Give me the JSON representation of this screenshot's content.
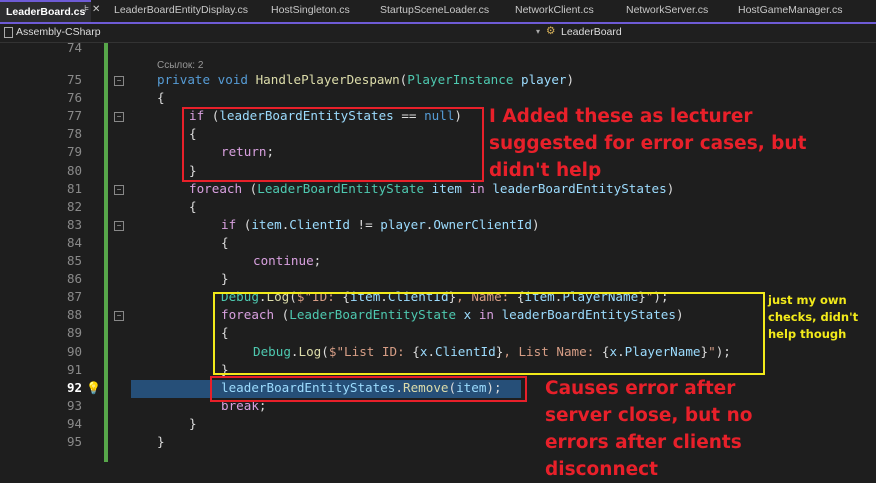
{
  "tabs": [
    {
      "label": "LeaderBoard.cs",
      "active": true
    },
    {
      "label": "LeaderBoardEntityDisplay.cs"
    },
    {
      "label": "HostSingleton.cs"
    },
    {
      "label": "StartupSceneLoader.cs"
    },
    {
      "label": "NetworkClient.cs"
    },
    {
      "label": "NetworkServer.cs"
    },
    {
      "label": "HostGameManager.cs"
    }
  ],
  "navbar": {
    "project": "Assembly-CSharp",
    "member": "LeaderBoard"
  },
  "codelens": "Ссылок: 2",
  "current_line": 92,
  "lines": [
    {
      "n": 74,
      "indent": 0,
      "t": []
    },
    {
      "n": 75,
      "indent": 0,
      "fold": true,
      "t": [
        [
          "private ",
          "kw"
        ],
        [
          "void ",
          "kw"
        ],
        [
          "HandlePlayerDespawn",
          "mt"
        ],
        [
          "(",
          "pl"
        ],
        [
          "PlayerInstance",
          "ty"
        ],
        [
          " player",
          "id"
        ],
        [
          ")",
          "pl"
        ]
      ]
    },
    {
      "n": 76,
      "indent": 0,
      "t": [
        [
          "{",
          "pl"
        ]
      ]
    },
    {
      "n": 77,
      "indent": 1,
      "fold": true,
      "t": [
        [
          "if ",
          "ctl"
        ],
        [
          "(",
          "pl"
        ],
        [
          "leaderBoardEntityStates",
          "id"
        ],
        [
          " == ",
          "pl"
        ],
        [
          "null",
          "kw"
        ],
        [
          ")",
          "pl"
        ]
      ]
    },
    {
      "n": 78,
      "indent": 1,
      "t": [
        [
          "{",
          "pl"
        ]
      ]
    },
    {
      "n": 79,
      "indent": 2,
      "t": [
        [
          "return",
          "ctl"
        ],
        [
          ";",
          "pl"
        ]
      ]
    },
    {
      "n": 80,
      "indent": 1,
      "t": [
        [
          "}",
          "pl"
        ]
      ]
    },
    {
      "n": 81,
      "indent": 1,
      "fold": true,
      "t": [
        [
          "foreach ",
          "ctl"
        ],
        [
          "(",
          "pl"
        ],
        [
          "LeaderBoardEntityState",
          "ty"
        ],
        [
          " item ",
          "id"
        ],
        [
          "in ",
          "ctl"
        ],
        [
          "leaderBoardEntityStates",
          "id"
        ],
        [
          ")",
          "pl"
        ]
      ]
    },
    {
      "n": 82,
      "indent": 1,
      "t": [
        [
          "{",
          "pl"
        ]
      ]
    },
    {
      "n": 83,
      "indent": 2,
      "fold": true,
      "t": [
        [
          "if ",
          "ctl"
        ],
        [
          "(",
          "pl"
        ],
        [
          "item",
          "id"
        ],
        [
          ".",
          "pl"
        ],
        [
          "ClientId",
          "id"
        ],
        [
          " != ",
          "pl"
        ],
        [
          "player",
          "id"
        ],
        [
          ".",
          "pl"
        ],
        [
          "OwnerClientId",
          "id"
        ],
        [
          ")",
          "pl"
        ]
      ]
    },
    {
      "n": 84,
      "indent": 2,
      "t": [
        [
          "{",
          "pl"
        ]
      ]
    },
    {
      "n": 85,
      "indent": 3,
      "t": [
        [
          "continue",
          "ctl"
        ],
        [
          ";",
          "pl"
        ]
      ]
    },
    {
      "n": 86,
      "indent": 2,
      "t": [
        [
          "}",
          "pl"
        ]
      ]
    },
    {
      "n": 87,
      "indent": 2,
      "t": [
        [
          "Debug",
          "ty"
        ],
        [
          ".",
          "pl"
        ],
        [
          "Log",
          "mt"
        ],
        [
          "(",
          "pl"
        ],
        [
          "$\"ID: ",
          "st"
        ],
        [
          "{",
          "pl"
        ],
        [
          "item",
          "id"
        ],
        [
          ".",
          "pl"
        ],
        [
          "ClientId",
          "id"
        ],
        [
          "}",
          "pl"
        ],
        [
          ", Name: ",
          "st"
        ],
        [
          "{",
          "pl"
        ],
        [
          "item",
          "id"
        ],
        [
          ".",
          "pl"
        ],
        [
          "PlayerName",
          "id"
        ],
        [
          "}",
          "pl"
        ],
        [
          "\"",
          "st"
        ],
        [
          ");",
          "pl"
        ]
      ]
    },
    {
      "n": 88,
      "indent": 2,
      "fold": true,
      "t": [
        [
          "foreach ",
          "ctl"
        ],
        [
          "(",
          "pl"
        ],
        [
          "LeaderBoardEntityState",
          "ty"
        ],
        [
          " x ",
          "id"
        ],
        [
          "in ",
          "ctl"
        ],
        [
          "leaderBoardEntityStates",
          "id"
        ],
        [
          ")",
          "pl"
        ]
      ]
    },
    {
      "n": 89,
      "indent": 2,
      "t": [
        [
          "{",
          "pl"
        ]
      ]
    },
    {
      "n": 90,
      "indent": 3,
      "t": [
        [
          "Debug",
          "ty"
        ],
        [
          ".",
          "pl"
        ],
        [
          "Log",
          "mt"
        ],
        [
          "(",
          "pl"
        ],
        [
          "$\"List ID: ",
          "st"
        ],
        [
          "{",
          "pl"
        ],
        [
          "x",
          "id"
        ],
        [
          ".",
          "pl"
        ],
        [
          "ClientId",
          "id"
        ],
        [
          "}",
          "pl"
        ],
        [
          ", List Name: ",
          "st"
        ],
        [
          "{",
          "pl"
        ],
        [
          "x",
          "id"
        ],
        [
          ".",
          "pl"
        ],
        [
          "PlayerName",
          "id"
        ],
        [
          "}",
          "pl"
        ],
        [
          "\"",
          "st"
        ],
        [
          ");",
          "pl"
        ]
      ]
    },
    {
      "n": 91,
      "indent": 2,
      "t": [
        [
          "}",
          "pl"
        ]
      ]
    },
    {
      "n": 92,
      "indent": 2,
      "t": [
        [
          "leaderBoardEntityStates",
          "id"
        ],
        [
          ".",
          "pl"
        ],
        [
          "Remove",
          "mt"
        ],
        [
          "(",
          "pl"
        ],
        [
          "item",
          "id"
        ],
        [
          ");",
          "pl"
        ]
      ]
    },
    {
      "n": 93,
      "indent": 2,
      "t": [
        [
          "break",
          "ctl"
        ],
        [
          ";",
          "pl"
        ]
      ]
    },
    {
      "n": 94,
      "indent": 1,
      "t": [
        [
          "}",
          "pl"
        ]
      ]
    },
    {
      "n": 95,
      "indent": 0,
      "t": [
        [
          "}",
          "pl"
        ]
      ]
    }
  ],
  "annotations": {
    "note1": "I Added these as lecturer suggested for error cases, but didn't help",
    "note2": "just my own checks, didn't help though",
    "note3": "Causes error after server close, but no errors after clients disconnect"
  },
  "colors": {
    "red": "#e8202a",
    "yellow": "#f2ea1a",
    "accent": "#6e5bd6"
  }
}
